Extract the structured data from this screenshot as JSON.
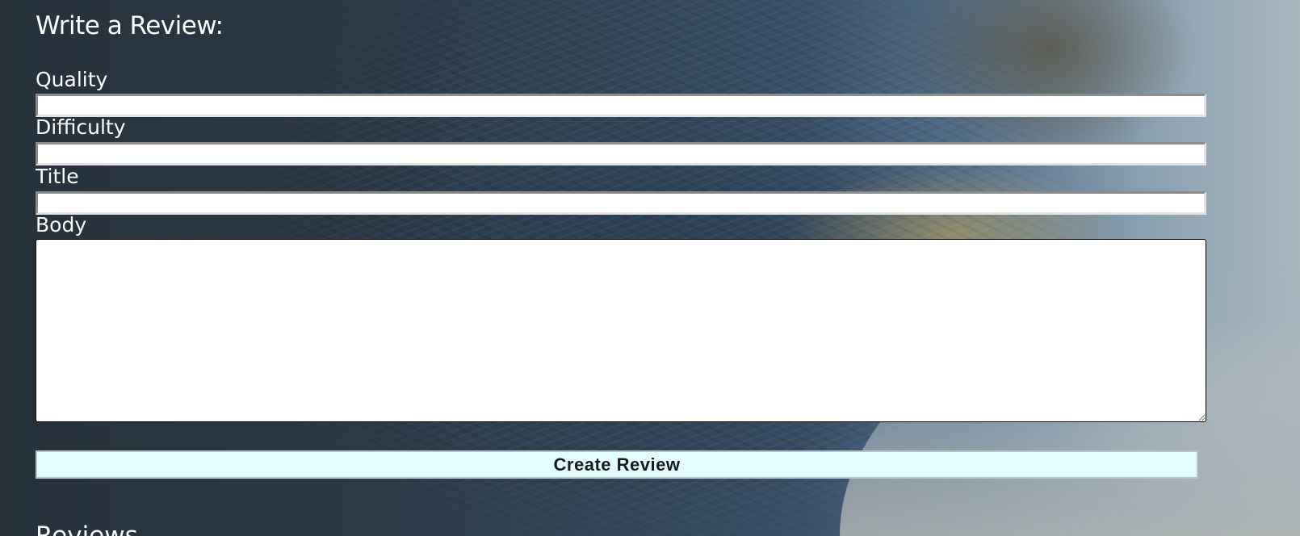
{
  "form": {
    "heading": "Write a Review:",
    "fields": [
      {
        "label": "Quality",
        "value": "",
        "placeholder": ""
      },
      {
        "label": "Difficulty",
        "value": "",
        "placeholder": ""
      },
      {
        "label": "Title",
        "value": "",
        "placeholder": ""
      }
    ],
    "body": {
      "label": "Body",
      "value": "",
      "placeholder": ""
    },
    "submit_label": "Create Review"
  },
  "reviews": {
    "heading": "Reviews"
  }
}
